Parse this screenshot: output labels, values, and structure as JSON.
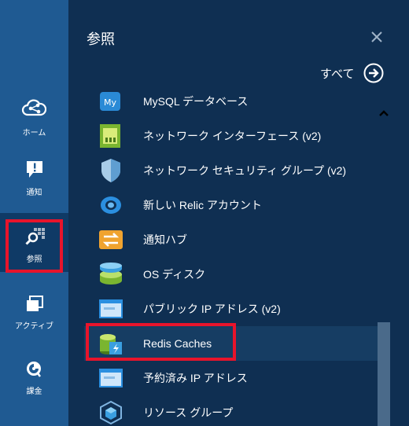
{
  "nav": {
    "items": [
      {
        "label": "ホーム",
        "icon": "cloud-icon"
      },
      {
        "label": "通知",
        "icon": "notification-icon"
      },
      {
        "label": "参照",
        "icon": "browse-icon"
      },
      {
        "label": "アクティブ",
        "icon": "active-windows-icon"
      },
      {
        "label": "課金",
        "icon": "billing-icon"
      }
    ]
  },
  "panel": {
    "title": "参照",
    "all_label": "すべて",
    "items": [
      {
        "label": "MySQL データベース",
        "icon": "mysql-icon"
      },
      {
        "label": "ネットワーク インターフェース (v2)",
        "icon": "network-interface-icon"
      },
      {
        "label": "ネットワーク セキュリティ グループ (v2)",
        "icon": "security-shield-icon"
      },
      {
        "label": "新しい Relic アカウント",
        "icon": "new-relic-icon"
      },
      {
        "label": "通知ハブ",
        "icon": "notification-hub-icon"
      },
      {
        "label": "OS ディスク",
        "icon": "os-disk-icon"
      },
      {
        "label": "パブリック IP アドレス (v2)",
        "icon": "public-ip-icon"
      },
      {
        "label": "Redis Caches",
        "icon": "redis-cache-icon"
      },
      {
        "label": "予約済み IP アドレス",
        "icon": "reserved-ip-icon"
      },
      {
        "label": "リソース グループ",
        "icon": "resource-group-icon"
      }
    ]
  },
  "colors": {
    "highlight": "#e8142b",
    "nav_bg": "#1f5a92",
    "panel_bg": "#0f2f52"
  }
}
